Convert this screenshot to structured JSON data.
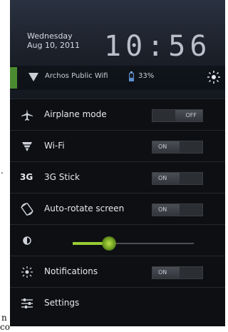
{
  "background_text": {
    "dot": ".",
    "n": "n",
    "co": "co"
  },
  "header": {
    "weekday": "Wednesday",
    "date": "Aug 10, 2011",
    "time": "10:56"
  },
  "status": {
    "wifi_network": "Archos Public Wifi",
    "battery": "33%"
  },
  "rows": [
    {
      "label": "Airplane mode",
      "icon": "airplane-icon",
      "toggle": "OFF"
    },
    {
      "label": "Wi-Fi",
      "icon": "wifi-icon",
      "toggle": "ON"
    },
    {
      "label": "3G Stick",
      "icon_text": "3G",
      "toggle": "ON"
    },
    {
      "label": "Auto-rotate screen",
      "icon": "rotate-icon",
      "toggle": "ON"
    },
    {
      "label": "",
      "icon": "brightness-icon",
      "slider_value": 0.3
    },
    {
      "label": "Notifications",
      "icon": "notifications-icon",
      "toggle": "ON"
    },
    {
      "label": "Settings",
      "icon": "settings-icon"
    }
  ],
  "colors": {
    "accent": "#99cc33",
    "panel": "#0d0f12"
  }
}
